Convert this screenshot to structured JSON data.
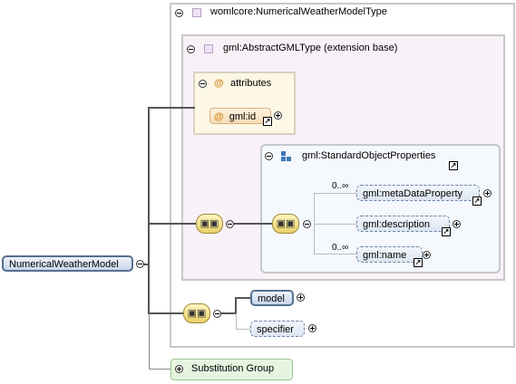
{
  "root_element": {
    "label": "NumericalWeatherModel"
  },
  "type": {
    "label": "womlcore:NumericalWeatherModelType"
  },
  "extension": {
    "label": "gml:AbstractGMLType (extension base)"
  },
  "attributes": {
    "title": "attributes",
    "items": [
      {
        "label": "gml:id"
      }
    ]
  },
  "group": {
    "label": "gml:StandardObjectProperties",
    "items": [
      {
        "label": "gml:metaDataProperty",
        "occurs": "0..∞"
      },
      {
        "label": "gml:description",
        "occurs": ""
      },
      {
        "label": "gml:name",
        "occurs": "0..∞"
      }
    ]
  },
  "sequence_items": [
    {
      "label": "model"
    },
    {
      "label": "specifier"
    }
  ],
  "substitution_group": {
    "label": "Substitution Group"
  },
  "colors": {
    "element_border": "#6a85a8",
    "attribute_fill": "#fdf7e5",
    "extension_fill": "#f8f2f8",
    "sequence_fill": "#e9d067",
    "substitution_fill": "#e6f5e0"
  }
}
